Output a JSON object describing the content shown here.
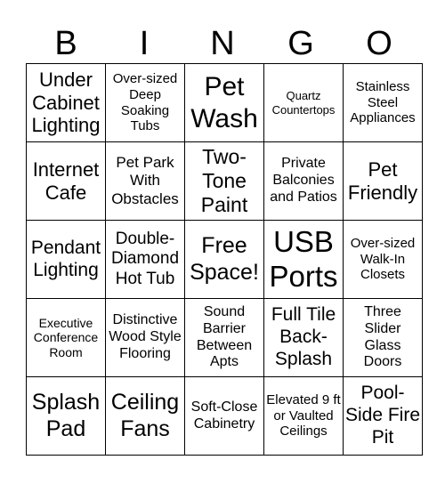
{
  "header": [
    "B",
    "I",
    "N",
    "G",
    "O"
  ],
  "cells": [
    [
      "Under Cabinet Lighting",
      "Over-sized Deep Soaking Tubs",
      "Pet Wash",
      "Quartz Countertops",
      "Stainless Steel Appliances"
    ],
    [
      "Internet Cafe",
      "Pet Park With Obstacles",
      "Two-Tone Paint",
      "Private Balconies and Patios",
      "Pet Friendly"
    ],
    [
      "Pendant Lighting",
      "Double-Diamond Hot Tub",
      "Free Space!",
      "USB Ports",
      "Over-sized Walk-In Closets"
    ],
    [
      "Executive Conference Room",
      "Distinctive Wood Style Flooring",
      "Sound Barrier Between Apts",
      "Full Tile Back-Splash",
      "Three Slider Glass Doors"
    ],
    [
      "Splash Pad",
      "Ceiling Fans",
      "Soft-Close Cabinetry",
      "Elevated 9 ft or Vaulted Ceilings",
      "Pool-Side Fire Pit"
    ]
  ]
}
